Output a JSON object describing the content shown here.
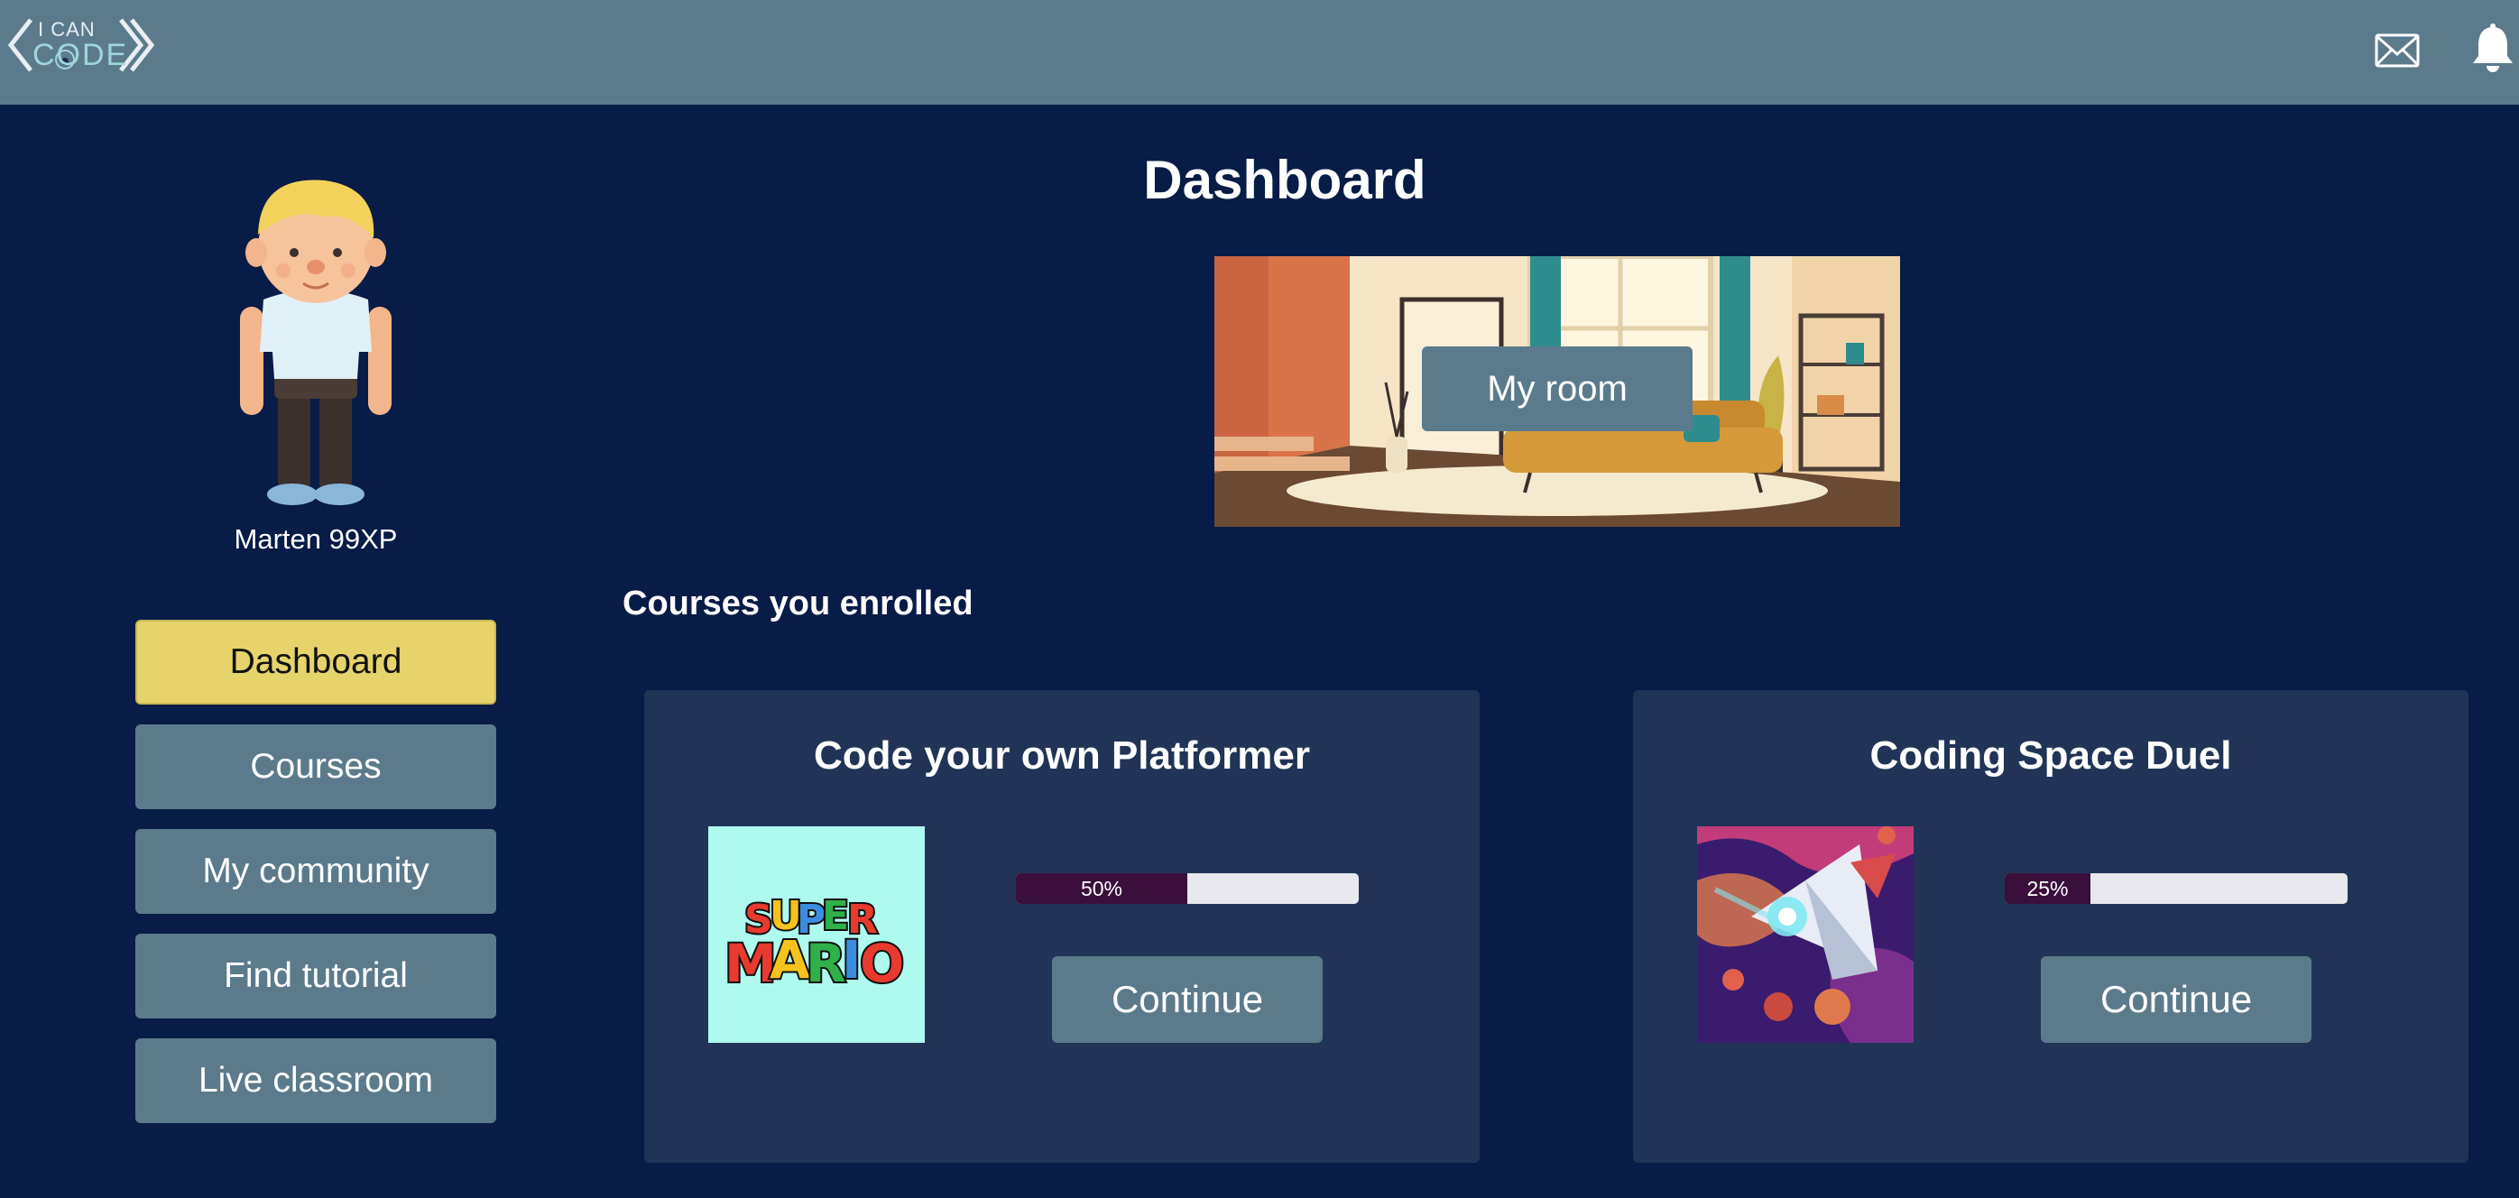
{
  "header": {
    "logo": {
      "line1": "I CAN",
      "line2": "CODE"
    },
    "icons": {
      "mail": "mail-icon",
      "notifications": "bell-icon"
    }
  },
  "sidebar": {
    "user_name": "Marten 99XP",
    "nav": [
      {
        "label": "Dashboard",
        "active": true
      },
      {
        "label": "Courses",
        "active": false
      },
      {
        "label": "My community",
        "active": false
      },
      {
        "label": "Find tutorial",
        "active": false
      },
      {
        "label": "Live classroom",
        "active": false
      }
    ]
  },
  "main": {
    "title": "Dashboard",
    "room_button": "My room",
    "section_title": "Courses you enrolled",
    "courses": [
      {
        "title": "Code your own Platformer",
        "thumbnail": "super-mario-logo",
        "progress": 50,
        "progress_label": "50%",
        "button": "Continue"
      },
      {
        "title": "Coding Space Duel",
        "thumbnail": "space-ship-art",
        "progress": 25,
        "progress_label": "25%",
        "button": "Continue"
      }
    ]
  },
  "colors": {
    "background": "#071c47",
    "topbar": "#5b7b8c",
    "button": "#5b7b8c",
    "active_nav": "#e6d46b",
    "card": "#213457",
    "progress_fill": "#3a0f3c",
    "progress_track": "#e8e8ee"
  }
}
